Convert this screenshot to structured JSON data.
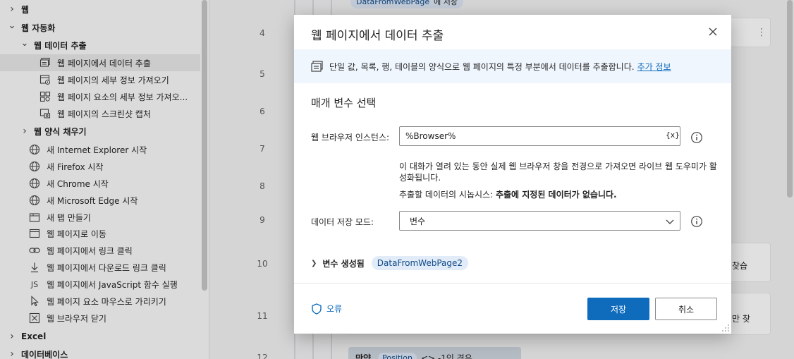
{
  "actions_panel": {
    "items": [
      {
        "label": "웹",
        "level": 0,
        "expander": "collapsed",
        "bold": true
      },
      {
        "label": "웹 자동화",
        "level": 0,
        "expander": "expanded",
        "bold": true
      },
      {
        "label": "웹 데이터 추출",
        "level": 1,
        "expander": "expanded",
        "bold": true
      },
      {
        "label": "웹 페이지에서 데이터 추출",
        "level": 2,
        "icon": "extract-data-icon",
        "selected": true
      },
      {
        "label": "웹 페이지의 세부 정보 가져오기",
        "level": 2,
        "icon": "page-details-icon"
      },
      {
        "label": "웹 페이지 요소의 세부 정보 가져오...",
        "level": 2,
        "icon": "element-details-icon"
      },
      {
        "label": "웹 페이지의 스크린샷 캡처",
        "level": 2,
        "icon": "screenshot-icon"
      },
      {
        "label": "웹 양식 채우기",
        "level": 1,
        "expander": "collapsed",
        "bold": true
      },
      {
        "label": "새 Internet Explorer 시작",
        "level": 1,
        "icon": "globe-icon"
      },
      {
        "label": "새 Firefox 시작",
        "level": 1,
        "icon": "globe-icon"
      },
      {
        "label": "새 Chrome 시작",
        "level": 1,
        "icon": "globe-icon"
      },
      {
        "label": "새 Microsoft Edge 시작",
        "level": 1,
        "icon": "globe-icon"
      },
      {
        "label": "새 탭 만들기",
        "level": 1,
        "icon": "new-tab-icon"
      },
      {
        "label": "웹 페이지로 이동",
        "level": 1,
        "icon": "browser-window-icon"
      },
      {
        "label": "웹 페이지에서 링크 클릭",
        "level": 1,
        "icon": "link-icon"
      },
      {
        "label": "웹 페이지에서 다운로드 링크 클릭",
        "level": 1,
        "icon": "download-icon"
      },
      {
        "label": "웹 페이지에서 JavaScript 함수 실행",
        "level": 1,
        "icon": "javascript-icon",
        "icon_text": "JS"
      },
      {
        "label": "웹 페이지 요소 마우스로 가리키기",
        "level": 1,
        "icon": "cursor-icon"
      },
      {
        "label": "웹 브라우저 닫기",
        "level": 1,
        "icon": "close-box-icon"
      },
      {
        "label": "Excel",
        "level": 0,
        "expander": "collapsed",
        "bold": true
      },
      {
        "label": "데이터베이스",
        "level": 0,
        "expander": "collapsed",
        "bold": true
      }
    ]
  },
  "workspace": {
    "line_numbers": [
      "4",
      "5",
      "6",
      "7",
      "8",
      "9",
      "10",
      "11",
      "12"
    ],
    "background_var": "DataFromWebPage",
    "background_var_suffix": "에 저장",
    "bg_text_line10": "찾습",
    "bg_text_line11": "만 찾",
    "if_block": {
      "keyword": "만약",
      "var": "Position",
      "rest": "<> -1인 경우"
    }
  },
  "dialog": {
    "title": "웹 페이지에서 데이터 추출",
    "banner_text": "단일 값, 목록, 행, 테이블의 양식으로 웹 페이지의 특정 부분에서 데이터를 추출합니다.",
    "banner_link": "추가 정보",
    "section_title": "매개 변수 선택",
    "browser_label": "웹 브라우저 인스턴스:",
    "browser_value": "%Browser%",
    "var_picker": "{x}",
    "helper_text": "이 대화가 열려 있는 동안 실제 웹 브라우저 창을 전경으로 가져오면 라이브 웹 도우미가 활성화됩니다.",
    "preview_label": "추출할 데이터의 시놉시스: ",
    "preview_value": "추출에 지정된 데이터가 없습니다.",
    "mode_label": "데이터 저장 모드:",
    "mode_value": "변수",
    "variables_label": "변수 생성됨",
    "output_variable": "DataFromWebPage2",
    "errors_label": "오류",
    "save_label": "저장",
    "cancel_label": "취소"
  },
  "colors": {
    "accent": "#0f6cbd",
    "banner_bg": "#f0f6fe",
    "pill_bg": "#e2ecf8"
  }
}
